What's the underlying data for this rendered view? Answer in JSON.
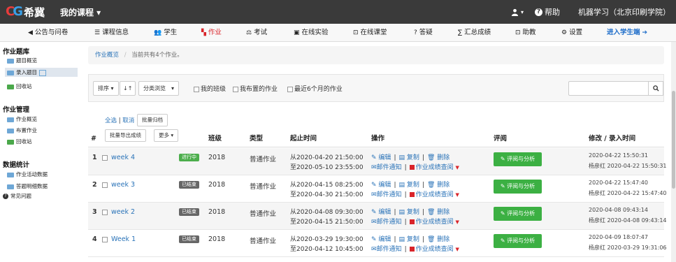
{
  "topbar": {
    "logo_text": "希冀",
    "course_menu": "我的课程 ▾",
    "user_caret": "▾",
    "help": "帮助",
    "course_title": "机器学习（北京印刷学院）"
  },
  "nav": [
    {
      "icon": "megaphone-icon",
      "glyph": "◀",
      "label": "公告与问卷"
    },
    {
      "icon": "list-icon",
      "glyph": "☰",
      "label": "课程信息"
    },
    {
      "icon": "users-icon",
      "glyph": "👥",
      "label": "学生"
    },
    {
      "icon": "homework-icon",
      "glyph": "▚",
      "label": "作业"
    },
    {
      "icon": "exam-icon",
      "glyph": "⚖",
      "label": "考试"
    },
    {
      "icon": "monitor-icon",
      "glyph": "▣",
      "label": "在线实验"
    },
    {
      "icon": "classroom-icon",
      "glyph": "⊡",
      "label": "在线课堂"
    },
    {
      "icon": "question-icon",
      "glyph": "?",
      "label": "答疑"
    },
    {
      "icon": "sigma-icon",
      "glyph": "∑",
      "label": "汇总成绩"
    },
    {
      "icon": "assistant-icon",
      "glyph": "⊡",
      "label": "助教"
    },
    {
      "icon": "gear-icon",
      "glyph": "⚙",
      "label": "设置"
    },
    {
      "icon": "arrow-right-icon",
      "glyph": "➔",
      "label": "进入学生端"
    }
  ],
  "sidebar": {
    "groups": [
      {
        "title": "作业题库",
        "items": [
          "题目概览",
          "录入题目",
          "回收站"
        ]
      },
      {
        "title": "作业管理",
        "items": [
          "作业概览",
          "布置作业",
          "回收站"
        ]
      },
      {
        "title": "数据统计",
        "items": [
          "作业活动数据",
          "答题明细数据",
          "常见问题"
        ]
      }
    ]
  },
  "breadcrumb": {
    "link": "作业概览",
    "sep": "/",
    "text": "当前共有4个作业。"
  },
  "toolbar": {
    "sort_label": "排序 ▾",
    "order_glyph": "↓↑",
    "category_label": "分类浏览　▾",
    "filters": [
      "我的班级",
      "我布置的作业",
      "最近6个月的作业"
    ],
    "search_placeholder": ""
  },
  "selection": {
    "all": "全选",
    "sep": "|",
    "cancel": "取消",
    "archive": "批量归档",
    "export": "批量导出成绩",
    "more": "更多 ▾"
  },
  "table": {
    "headers": {
      "num": "#",
      "class": "班级",
      "type": "类型",
      "time": "起止时间",
      "ops": "操作",
      "eval": "评阅",
      "modified": "修改 / 录入时间"
    },
    "rows": [
      {
        "num": "1",
        "name": "week 4",
        "status": "进行中",
        "status_key": "running",
        "year": "2018",
        "type": "普通作业",
        "start": "从2020-04-20 21:50:00",
        "end": "至2020-05-10 23:55:00",
        "modified": "2020-04-22 15:50:31",
        "created": "杨彦红 2020-04-22 15:50:31"
      },
      {
        "num": "2",
        "name": "week 3",
        "status": "已结束",
        "status_key": "ended",
        "year": "2018",
        "type": "普通作业",
        "start": "从2020-04-15 08:25:00",
        "end": "至2020-04-30 21:50:00",
        "modified": "2020-04-22 15:47:40",
        "created": "杨彦红 2020-04-22 15:47:40"
      },
      {
        "num": "3",
        "name": "week 2",
        "status": "已结束",
        "status_key": "ended",
        "year": "2018",
        "type": "普通作业",
        "start": "从2020-04-08 09:30:00",
        "end": "至2020-04-15 21:50:00",
        "modified": "2020-04-08 09:43:14",
        "created": "杨彦红 2020-04-08 09:43:14"
      },
      {
        "num": "4",
        "name": "Week 1",
        "status": "已结束",
        "status_key": "ended",
        "year": "2018",
        "type": "普通作业",
        "start": "从2020-03-29 19:30:00",
        "end": "至2020-04-12 10:45:00",
        "modified": "2020-04-09 18:07:47",
        "created": "杨彦红 2020-03-29 19:31:06"
      }
    ],
    "ops": {
      "edit": "编辑",
      "copy": "复制",
      "delete": "删除",
      "mail": "邮件通知",
      "grades": "作业成绩查阅"
    },
    "eval_button": "评阅与分析"
  },
  "colors": {
    "accent": "#2a73b8",
    "active_red": "#d9242a",
    "green": "#3cb043",
    "topbar": "#3a3a3a"
  }
}
